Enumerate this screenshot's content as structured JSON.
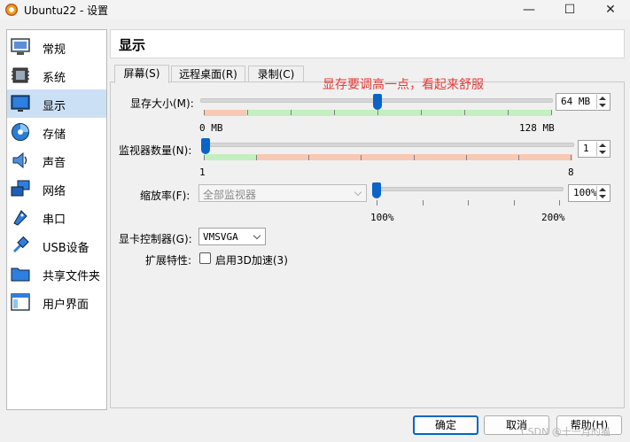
{
  "window": {
    "title": "Ubuntu22 - 设置",
    "minimize": "—",
    "maximize": "☐",
    "close": "✕"
  },
  "sidebar": {
    "items": [
      {
        "label": "常规"
      },
      {
        "label": "系统"
      },
      {
        "label": "显示"
      },
      {
        "label": "存储"
      },
      {
        "label": "声音"
      },
      {
        "label": "网络"
      },
      {
        "label": "串口"
      },
      {
        "label": "USB设备"
      },
      {
        "label": "共享文件夹"
      },
      {
        "label": "用户界面"
      }
    ],
    "selected": "显示"
  },
  "header": {
    "title": "显示"
  },
  "tabs": [
    {
      "label": "屏幕(S)",
      "active": true
    },
    {
      "label": "远程桌面(R)",
      "active": false
    },
    {
      "label": "录制(C)",
      "active": false
    }
  ],
  "annotation": "显存要调高一点，看起来舒服",
  "screen": {
    "video_memory": {
      "label": "显存大小(M):",
      "value": "64 MB",
      "min_label": "0 MB",
      "max_label": "128 MB",
      "level": 0.5
    },
    "monitors": {
      "label": "监视器数量(N):",
      "value": "1",
      "min_label": "1",
      "max_label": "8",
      "level": 0.0
    },
    "scale": {
      "label": "缩放率(F):",
      "select_value": "全部监视器",
      "value": "100%",
      "min_label": "100%",
      "max_label": "200%",
      "level": 0.0
    },
    "controller": {
      "label": "显卡控制器(G):",
      "value": "VMSVGA"
    },
    "features": {
      "label": "扩展特性:",
      "checkbox_label": "启用3D加速(3)",
      "checked": false
    }
  },
  "buttons": {
    "ok": "确定",
    "cancel": "取消",
    "help": "帮助(H)"
  },
  "watermark": "CSDN @十一月的猫",
  "colors": {
    "accent": "#0a64c8",
    "band_green": "#c4efc0",
    "band_red": "#f7c9b5",
    "annotation": "#e53935",
    "selected_row": "#cce0f5"
  }
}
